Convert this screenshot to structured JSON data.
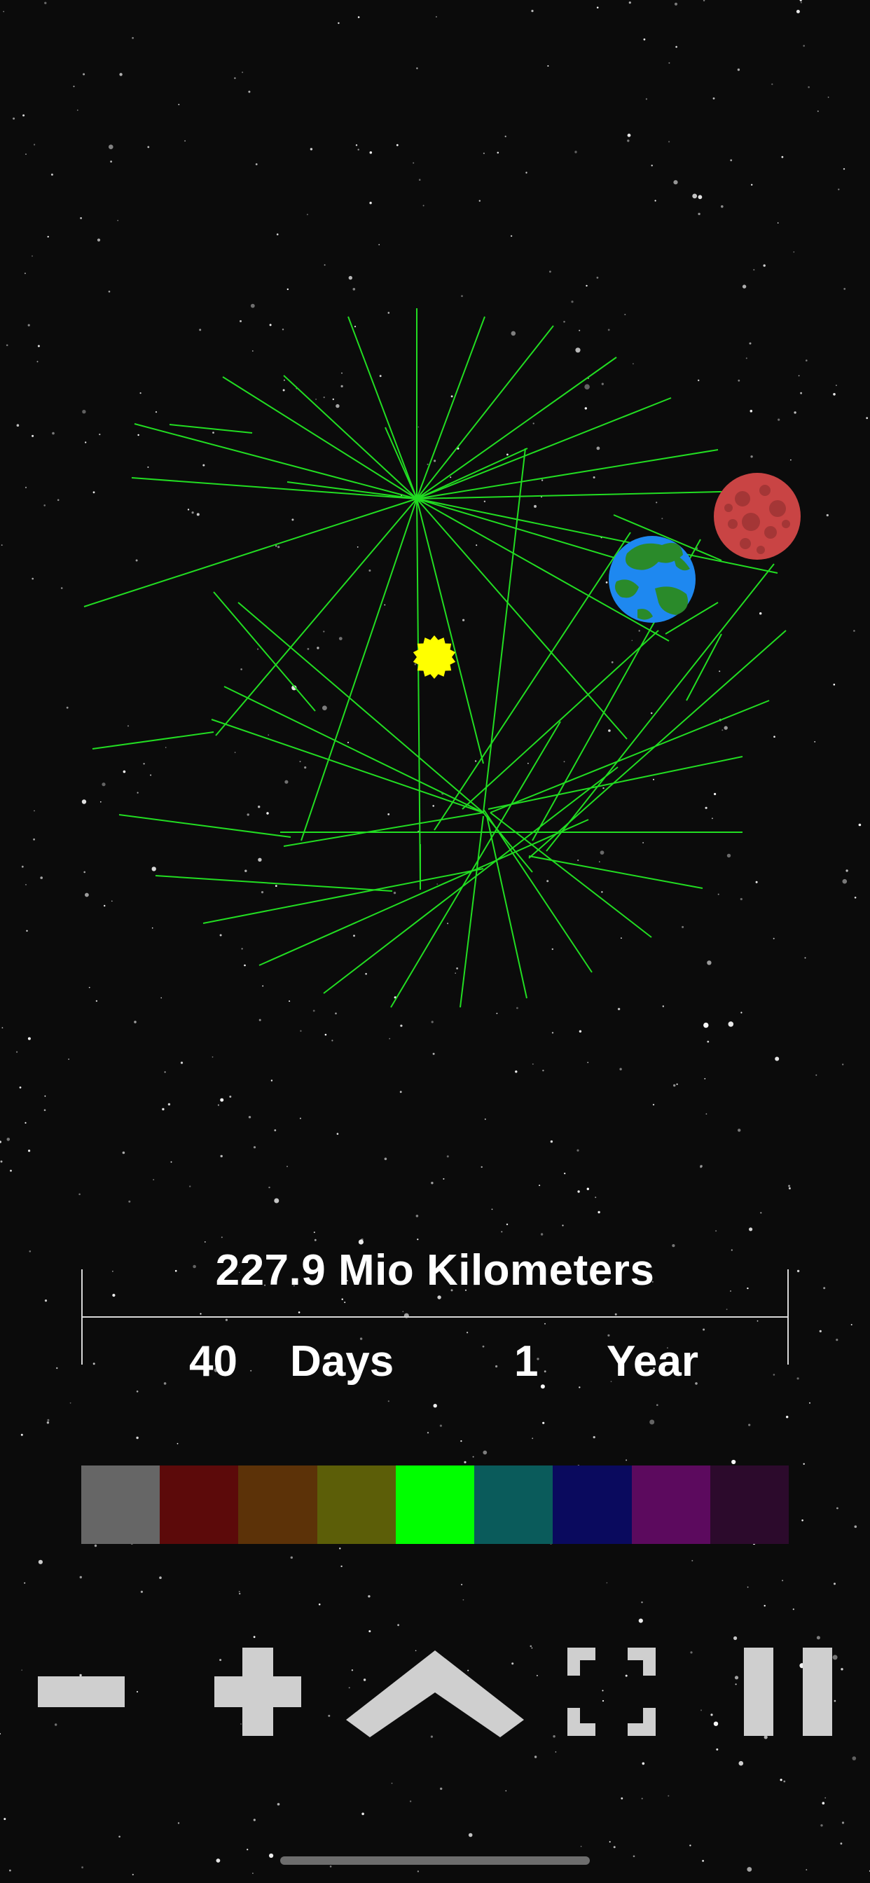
{
  "scale": {
    "distance": "227.9 Mio Kilometers",
    "days_value": "40",
    "days_label": "Days",
    "years_value": "1",
    "years_label": "Year"
  },
  "palette": {
    "colors": [
      "#666666",
      "#5c0a0a",
      "#5c3208",
      "#5c5e08",
      "#00ff00",
      "#0a5b5b",
      "#0a0a5e",
      "#5c0a5e",
      "#2c0a2c"
    ],
    "selected_index": 4
  },
  "orbit": {
    "line_color": "#22dd22"
  },
  "bodies": {
    "sun": {
      "name": "sun-icon",
      "color": "#ffff00"
    },
    "earth": {
      "name": "earth-planet",
      "colors": [
        "#1e88f0",
        "#2a8a2a"
      ]
    },
    "mars": {
      "name": "mars-planet",
      "colors": [
        "#c94444",
        "#a43636"
      ]
    }
  },
  "controls": [
    {
      "name": "zoom-out-button",
      "icon": "minus-icon"
    },
    {
      "name": "zoom-in-button",
      "icon": "plus-icon"
    },
    {
      "name": "expand-up-button",
      "icon": "chevron-up-icon"
    },
    {
      "name": "fullscreen-button",
      "icon": "fullscreen-icon"
    },
    {
      "name": "pause-button",
      "icon": "pause-icon"
    }
  ]
}
